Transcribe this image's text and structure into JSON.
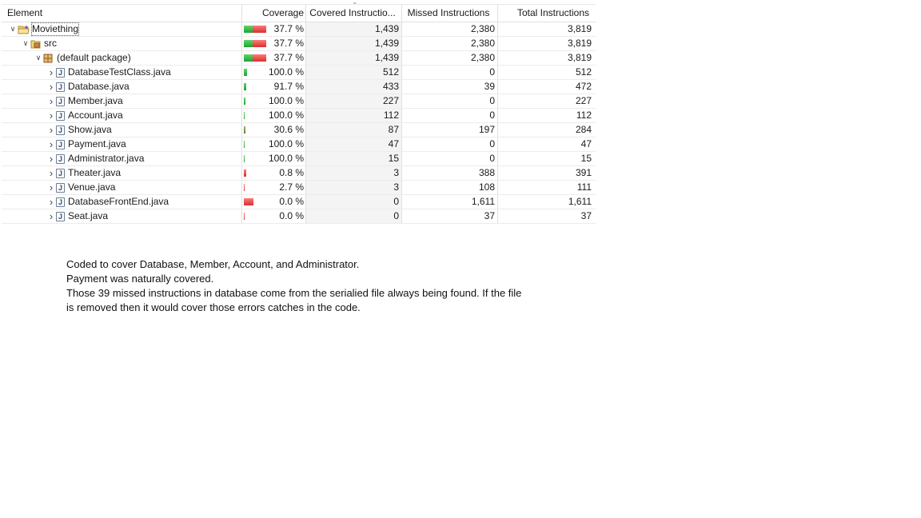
{
  "table": {
    "headers": {
      "element": "Element",
      "coverage": "Coverage",
      "covered": "Covered Instructio...",
      "missed": "Missed Instructions",
      "total": "Total Instructions"
    },
    "rows": [
      {
        "name": "Moviething",
        "icon": "project-folder-icon",
        "level": 0,
        "coverage": "37.7 %",
        "covered": "1,439",
        "missed": "2,380",
        "total": "3,819",
        "coverage_fraction": 0.377
      },
      {
        "name": "src",
        "icon": "source-folder-icon",
        "level": 1,
        "coverage": "37.7 %",
        "covered": "1,439",
        "missed": "2,380",
        "total": "3,819",
        "coverage_fraction": 0.377
      },
      {
        "name": "(default package)",
        "icon": "package-icon",
        "level": 2,
        "coverage": "37.7 %",
        "covered": "1,439",
        "missed": "2,380",
        "total": "3,819",
        "coverage_fraction": 0.377
      },
      {
        "name": "DatabaseTestClass.java",
        "icon": "java-file-icon",
        "level": 3,
        "coverage": "100.0 %",
        "covered": "512",
        "missed": "0",
        "total": "512",
        "coverage_fraction": 1.0
      },
      {
        "name": "Database.java",
        "icon": "java-file-icon",
        "level": 3,
        "coverage": "91.7 %",
        "covered": "433",
        "missed": "39",
        "total": "472",
        "coverage_fraction": 0.917
      },
      {
        "name": "Member.java",
        "icon": "java-file-icon",
        "level": 3,
        "coverage": "100.0 %",
        "covered": "227",
        "missed": "0",
        "total": "227",
        "coverage_fraction": 1.0
      },
      {
        "name": "Account.java",
        "icon": "java-file-icon",
        "level": 3,
        "coverage": "100.0 %",
        "covered": "112",
        "missed": "0",
        "total": "112",
        "coverage_fraction": 1.0
      },
      {
        "name": "Show.java",
        "icon": "java-file-icon",
        "level": 3,
        "coverage": "30.6 %",
        "covered": "87",
        "missed": "197",
        "total": "284",
        "coverage_fraction": 0.306
      },
      {
        "name": "Payment.java",
        "icon": "java-file-icon",
        "level": 3,
        "coverage": "100.0 %",
        "covered": "47",
        "missed": "0",
        "total": "47",
        "coverage_fraction": 1.0
      },
      {
        "name": "Administrator.java",
        "icon": "java-file-icon",
        "level": 3,
        "coverage": "100.0 %",
        "covered": "15",
        "missed": "0",
        "total": "15",
        "coverage_fraction": 1.0
      },
      {
        "name": "Theater.java",
        "icon": "java-file-icon",
        "level": 3,
        "coverage": "0.8 %",
        "covered": "3",
        "missed": "388",
        "total": "391",
        "coverage_fraction": 0.008
      },
      {
        "name": "Venue.java",
        "icon": "java-file-icon",
        "level": 3,
        "coverage": "2.7 %",
        "covered": "3",
        "missed": "108",
        "total": "111",
        "coverage_fraction": 0.027
      },
      {
        "name": "DatabaseFrontEnd.java",
        "icon": "java-file-icon",
        "level": 3,
        "coverage": "0.0 %",
        "covered": "0",
        "missed": "1,611",
        "total": "1,611",
        "coverage_fraction": 0.0
      },
      {
        "name": "Seat.java",
        "icon": "java-file-icon",
        "level": 3,
        "coverage": "0.0 %",
        "covered": "0",
        "missed": "37",
        "total": "37",
        "coverage_fraction": 0.0
      }
    ]
  },
  "note": {
    "lines": [
      "Coded to cover Database, Member, Account, and Administrator.",
      "Payment was naturally covered.",
      "Those 39 missed instructions in database come from the serialied file always being found. If the file",
      "is removed then it would cover those errors catches in the code."
    ]
  },
  "colors": {
    "covered_bar": "#20a332",
    "missed_bar": "#d73030"
  }
}
